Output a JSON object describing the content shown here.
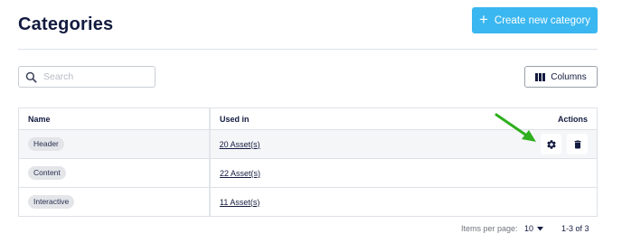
{
  "header": {
    "title": "Categories",
    "create_button_label": "Create new category",
    "create_button_icon": "plus-icon"
  },
  "toolbar": {
    "search_placeholder": "Search",
    "search_value": "",
    "columns_button_label": "Columns"
  },
  "table": {
    "columns": [
      "Name",
      "Used in",
      "Actions"
    ],
    "rows": [
      {
        "name": "Header",
        "used_in": "20 Asset(s)"
      },
      {
        "name": "Content",
        "used_in": "22 Asset(s)"
      },
      {
        "name": "Interactive",
        "used_in": "11 Asset(s)"
      }
    ],
    "row_actions": [
      "settings-icon",
      "trash-icon"
    ]
  },
  "pagination": {
    "items_per_page_label": "Items per page:",
    "items_per_page_value": "10",
    "range_text": "1-3 of 3"
  },
  "colors": {
    "primary": "#3ab7f0",
    "title_text": "#131b3f",
    "annotation_arrow": "#2fae1e"
  }
}
